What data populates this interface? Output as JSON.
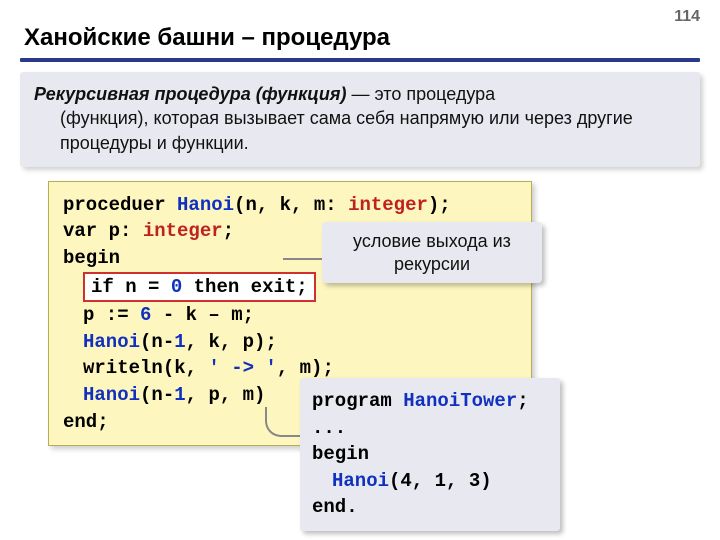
{
  "page_number": "114",
  "title": "Ханойские башни – процедура",
  "definition": {
    "term": "Рекурсивная процедура (функция)",
    "dash": " — это процедура",
    "rest": "(функция), которая вызывает сама себя напрямую или через другие процедуры и функции."
  },
  "code": {
    "l1": {
      "kw1": "proceduer ",
      "id": "Hanoi",
      "args": "(n, k, m: ",
      "type": "integer",
      "close": ");"
    },
    "l2": {
      "kw": "var ",
      "id": "p: ",
      "type": "integer",
      "semi": ";"
    },
    "l3": "begin",
    "l4": {
      "if": "if ",
      "n": "n",
      "eq": " = ",
      "zero": "0",
      "then": " then exit;"
    },
    "l5": {
      "pre": "p := ",
      "six": "6",
      "rest": " - k – m;"
    },
    "l6": {
      "id": "Hanoi",
      "open": "(n-",
      "one": "1",
      "rest": ", k, p);"
    },
    "l7": {
      "pre": "writeln(k, ",
      "str": "' -> '",
      "rest": ", m);"
    },
    "l8": {
      "id": "Hanoi",
      "open": "(n-",
      "one": "1",
      "rest": ", p, m)"
    },
    "l9": "end;"
  },
  "callout1": {
    "line1": "условие выхода из",
    "line2": "рекурсии"
  },
  "callout2": {
    "l1": {
      "kw": "program ",
      "id": "HanoiTower",
      "semi": ";"
    },
    "l2": "...",
    "l3": "begin",
    "l4": {
      "id": "Hanoi",
      "args": "(4, 1, 3)"
    },
    "l5": "end."
  }
}
